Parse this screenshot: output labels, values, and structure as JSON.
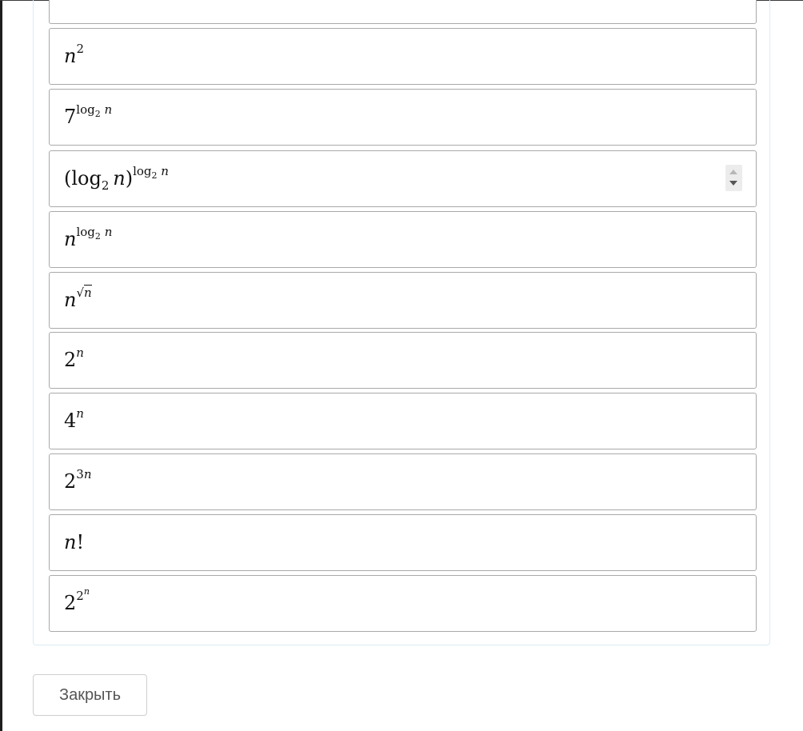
{
  "formulas": {
    "n2": {
      "base": "n",
      "exp": "2"
    },
    "seven_log": {
      "base": "7",
      "exp_fn": "log",
      "exp_sub": "2",
      "exp_var": "n"
    },
    "log_log": {
      "open": "(",
      "fn": "log",
      "sub": "2",
      "var": "n",
      "close": ")",
      "exp_fn": "log",
      "exp_sub": "2",
      "exp_var": "n"
    },
    "n_log": {
      "base": "n",
      "exp_fn": "log",
      "exp_sub": "2",
      "exp_var": "n"
    },
    "n_sqrt": {
      "base": "n",
      "radical": "√",
      "radicand": "n"
    },
    "two_n": {
      "base": "2",
      "exp": "n"
    },
    "four_n": {
      "base": "4",
      "exp": "n"
    },
    "two_3n": {
      "base": "2",
      "exp_num": "3",
      "exp_var": "n"
    },
    "n_fact": {
      "var": "n",
      "bang": "!"
    },
    "two_two_n": {
      "base": "2",
      "exp_base": "2",
      "exp_exp": "n"
    }
  },
  "spinner": {
    "up_icon": "triangle-up",
    "down_icon": "triangle-down"
  },
  "footer": {
    "close_label": "Закрыть"
  }
}
